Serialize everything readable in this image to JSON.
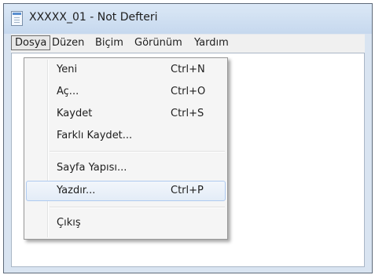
{
  "window": {
    "title": "XXXXX_01 - Not Defteri",
    "icon": "notepad-icon"
  },
  "menubar": {
    "items": [
      "Dosya",
      "Düzen",
      "Biçim",
      "Görünüm",
      "Yardım"
    ],
    "active": "Dosya"
  },
  "file_menu": {
    "items": [
      {
        "label": "Yeni",
        "shortcut": "Ctrl+N"
      },
      {
        "label": "Aç...",
        "shortcut": "Ctrl+O"
      },
      {
        "label": "Kaydet",
        "shortcut": "Ctrl+S"
      },
      {
        "label": "Farklı Kaydet...",
        "shortcut": ""
      },
      {
        "label": "Sayfa Yapısı...",
        "shortcut": ""
      },
      {
        "label": "Yazdır...",
        "shortcut": "Ctrl+P"
      },
      {
        "label": "Çıkış",
        "shortcut": ""
      }
    ],
    "highlighted": "Yazdır..."
  }
}
